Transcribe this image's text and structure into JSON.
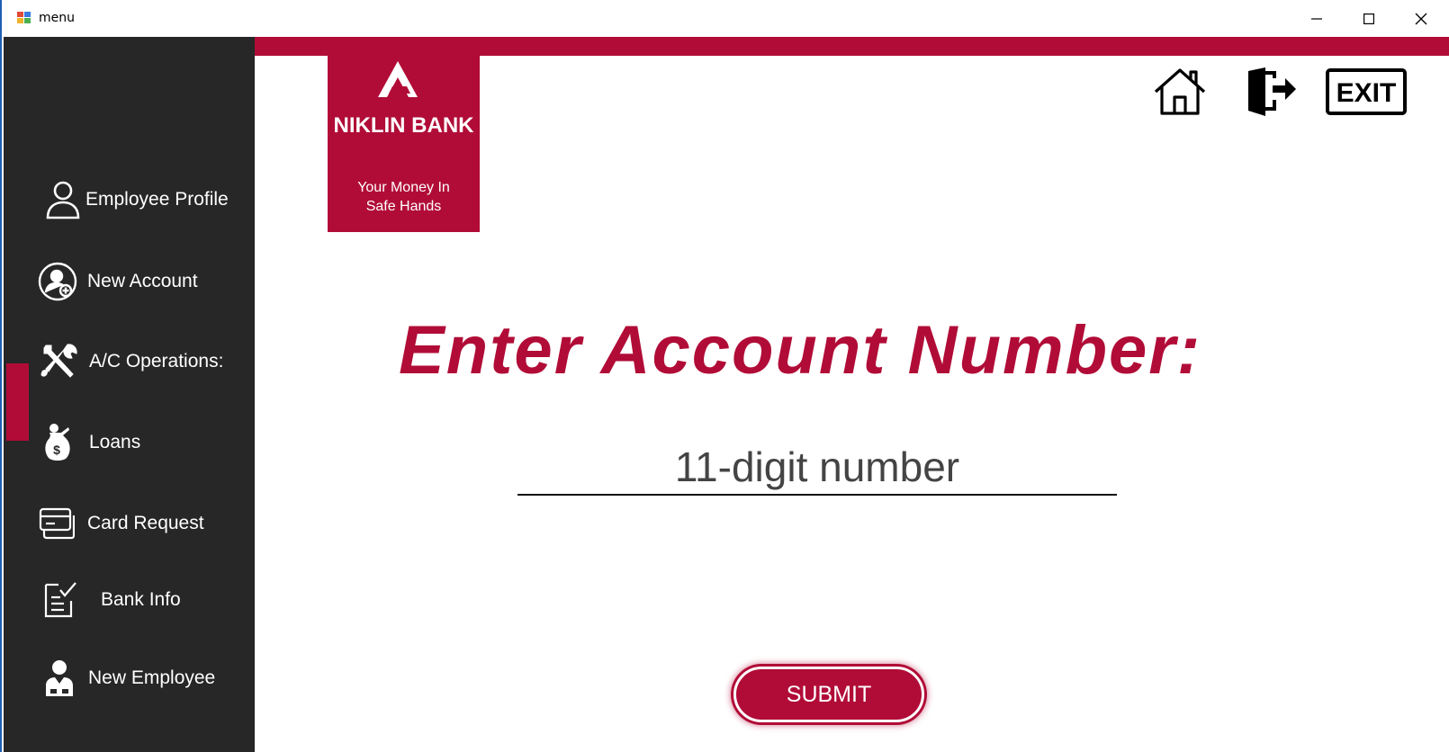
{
  "window": {
    "title": "menu",
    "controls": [
      "minimize",
      "maximize",
      "close"
    ]
  },
  "sidebar": {
    "items": [
      {
        "label": "Employee Profile",
        "icon": "user-icon"
      },
      {
        "label": "New Account",
        "icon": "add-user-icon"
      },
      {
        "label": "A/C Operations:",
        "icon": "tools-icon",
        "active": true
      },
      {
        "label": "Loans",
        "icon": "money-bag-icon"
      },
      {
        "label": "Card Request",
        "icon": "card-icon"
      },
      {
        "label": "Bank Info",
        "icon": "checklist-icon"
      },
      {
        "label": "New Employee",
        "icon": "employee-icon"
      }
    ]
  },
  "brand": {
    "name": "NIKLIN BANK",
    "tagline_line1": "Your Money In",
    "tagline_line2": "Safe Hands",
    "color": "#b10c37"
  },
  "toolbar": {
    "icons": [
      "home-icon",
      "logout-icon",
      "exit-icon"
    ],
    "exit_label": "EXIT"
  },
  "main": {
    "heading": "Enter Account Number:",
    "account_input": {
      "placeholder": "11-digit number",
      "value": ""
    },
    "submit_label": "SUBMIT"
  },
  "colors": {
    "sidebar_bg": "#272727",
    "accent": "#b10c37"
  }
}
